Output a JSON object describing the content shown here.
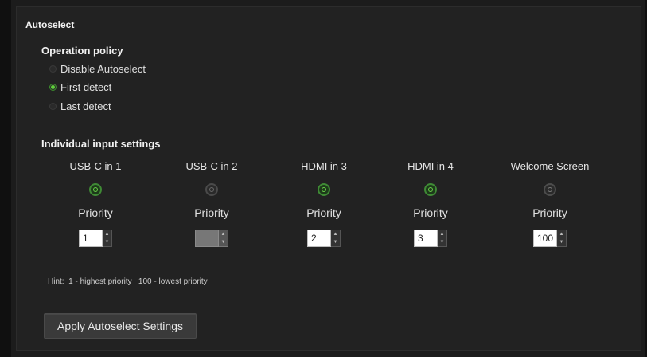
{
  "panel": {
    "title": "Autoselect"
  },
  "operation_policy": {
    "title": "Operation policy",
    "options": [
      {
        "label": "Disable Autoselect",
        "selected": false
      },
      {
        "label": "First detect",
        "selected": true
      },
      {
        "label": "Last detect",
        "selected": false
      }
    ]
  },
  "individual": {
    "title": "Individual input settings",
    "priority_label": "Priority",
    "inputs": [
      {
        "name": "USB-C in 1",
        "enabled": true,
        "priority": "1"
      },
      {
        "name": "USB-C in 2",
        "enabled": false,
        "priority": ""
      },
      {
        "name": "HDMI in 3",
        "enabled": true,
        "priority": "2"
      },
      {
        "name": "HDMI in 4",
        "enabled": true,
        "priority": "3"
      },
      {
        "name": "Welcome Screen",
        "enabled": false,
        "priority": "100"
      }
    ]
  },
  "hint": "Hint:  1 - highest priority   100 - lowest priority",
  "apply_button": "Apply Autoselect Settings",
  "colors": {
    "accent": "#5fcf3b",
    "background": "#222222"
  }
}
